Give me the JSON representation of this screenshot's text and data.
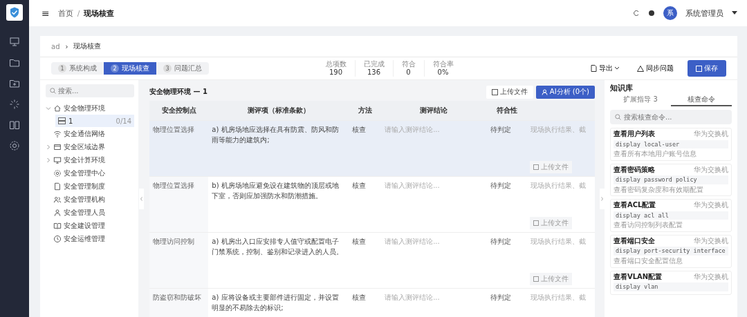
{
  "header": {
    "menu_icon": "≡",
    "separator": "/",
    "breadcrumb": [
      {
        "label": "首页",
        "current": false
      },
      {
        "label": "现场核查",
        "current": true
      }
    ],
    "avatar": "系",
    "user": "系统管理员"
  },
  "page_breadcrumb": {
    "root": "ad",
    "separator": "›",
    "current": "现场核查"
  },
  "steps": [
    {
      "number": "1",
      "label": "系统构成",
      "selected": false
    },
    {
      "number": "2",
      "label": "现场核查",
      "selected": true
    },
    {
      "number": "3",
      "label": "问题汇总",
      "selected": false
    }
  ],
  "stats": [
    {
      "label": "总项数",
      "value": "190"
    },
    {
      "label": "已完成",
      "value": "136"
    },
    {
      "label": "符合",
      "value": "0"
    },
    {
      "label": "符合率",
      "value": "0%"
    }
  ],
  "actions": [
    {
      "label": "导出",
      "kind": "dropdown"
    },
    {
      "label": "同步问题",
      "kind": "plain"
    },
    {
      "label": "保存",
      "kind": "primary"
    }
  ],
  "tree": {
    "search_placeholder": "搜索...",
    "items": [
      {
        "label": "安全物理环境",
        "expanded": true,
        "children": [
          {
            "label": "1",
            "count": "0/14",
            "selected": true
          }
        ]
      },
      {
        "label": "安全通信网络"
      },
      {
        "label": "安全区域边界",
        "expanded": false
      },
      {
        "label": "安全计算环境",
        "expanded": false
      },
      {
        "label": "安全管理中心"
      },
      {
        "label": "安全管理制度"
      },
      {
        "label": "安全管理机构"
      },
      {
        "label": "安全管理人员"
      },
      {
        "label": "安全建设管理"
      },
      {
        "label": "安全运维管理"
      }
    ]
  },
  "table_panel": {
    "title": "安全物理环境 — 1",
    "upload_button": "上传文件",
    "ai_button": "AI分析 (0个)",
    "columns": [
      "安全控制点",
      "测评项（标准条款）",
      "方法",
      "测评结论",
      "符合性"
    ],
    "rows": [
      {
        "control_point": "物理位置选择",
        "item": "a) 机房场地应选择在具有防震、防风和防雨等能力的建筑内;",
        "method": "核查",
        "conclusion_placeholder": "请输入测评结论...",
        "compliance": "待判定",
        "evidence": "现场执行结果、截",
        "upload": "上传文件",
        "selected": true
      },
      {
        "control_point": "物理位置选择",
        "item": "b) 机房场地应避免设在建筑物的顶层或地下室，否则应加强防水和防潮措施。",
        "method": "核查",
        "conclusion_placeholder": "请输入测评结论...",
        "compliance": "待判定",
        "evidence": "现场执行结果、截",
        "upload": "上传文件",
        "selected": false
      },
      {
        "control_point": "物理访问控制",
        "item": "a) 机房出入口应安排专人值守或配置电子门禁系统，控制、鉴别和记录进入的人员。",
        "method": "核查",
        "conclusion_placeholder": "请输入测评结论...",
        "compliance": "待判定",
        "evidence": "现场执行结果、截",
        "upload": "上传文件",
        "selected": false
      },
      {
        "control_point": "防盗窃和防破坏",
        "item": "a) 应将设备或主要部件进行固定，并设置明显的不易除去的标识;",
        "method": "核查",
        "conclusion_placeholder": "请输入测评结论...",
        "compliance": "待判定",
        "evidence": "现场执行结果、截",
        "selected": false
      }
    ]
  },
  "knowledge": {
    "title": "知识库",
    "tabs": [
      {
        "label": "扩展指导 3",
        "selected": false
      },
      {
        "label": "核查命令",
        "selected": true
      }
    ],
    "search_placeholder": "搜索核查命令...",
    "commands": [
      {
        "title": "查看用户列表",
        "tag": "华为交换机",
        "command": "display local-user",
        "description": "查看所有本地用户账号信息"
      },
      {
        "title": "查看密码策略",
        "tag": "华为交换机",
        "command": "display password policy",
        "description": "查看密码复杂度和有效期配置"
      },
      {
        "title": "查看ACL配置",
        "tag": "华为交换机",
        "command": "display acl all",
        "description": "查看访问控制列表配置"
      },
      {
        "title": "查看端口安全",
        "tag": "华为交换机",
        "command": "display port-security interface",
        "description": "查看端口安全配置信息"
      },
      {
        "title": "查看VLAN配置",
        "tag": "华为交换机",
        "command": "display vlan"
      }
    ]
  }
}
